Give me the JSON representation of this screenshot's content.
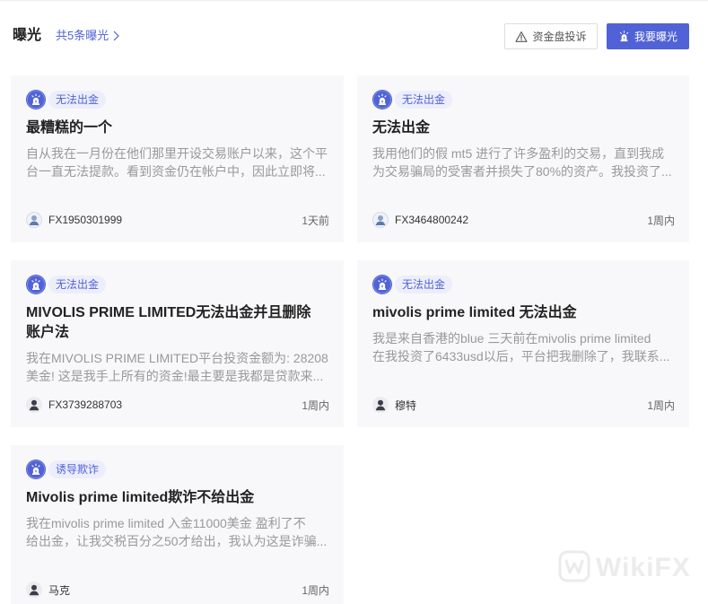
{
  "header": {
    "title": "曝光",
    "count_link": "共5条曝光",
    "count_link_icon": "chevron-right-icon",
    "complaint_button": "资金盘投诉",
    "complaint_icon": "warning-triangle-icon",
    "expose_button": "我要曝光",
    "expose_icon": "siren-icon"
  },
  "colors": {
    "accent": "#5062d6",
    "tag_background": "#eceefb",
    "card_background": "#f8f8fa",
    "title_text": "#222222",
    "muted_text": "#999999"
  },
  "cards": [
    {
      "icon": "siren-icon",
      "tag": "无法出金",
      "title_lines": [
        "最糟糕的一个"
      ],
      "description_lines": [
        "自从我在一月份在他们那里开设交易账户以来，这个平",
        "台一直无法提款。看到资金仍在帐户中，因此立即将..."
      ],
      "avatar": "user-avatar-icon",
      "author": "FX1950301999",
      "time": "1天前"
    },
    {
      "icon": "siren-icon",
      "tag": "无法出金",
      "title_lines": [
        "无法出金"
      ],
      "description_lines": [
        "我用他们的假 mt5 进行了许多盈利的交易，直到我成",
        "为交易骗局的受害者并损失了80%的资产。我投资了..."
      ],
      "avatar": "user-avatar-icon",
      "author": "FX3464800242",
      "time": "1周内"
    },
    {
      "icon": "siren-icon",
      "tag": "无法出金",
      "title_lines": [
        "MIVOLIS PRIME LIMITED无法出金并且删除",
        "账户法"
      ],
      "description_lines": [
        "我在MIVOLIS PRIME LIMITED平台投资金额为: 28208",
        "美金! 这是我手上所有的资金!最主要是我都是贷款来..."
      ],
      "avatar": "user-avatar-icon",
      "author": "FX3739288703",
      "time": "1周内"
    },
    {
      "icon": "siren-icon",
      "tag": "无法出金",
      "title_lines": [
        "mivolis prime limited 无法出金"
      ],
      "description_lines": [
        "我是来自香港的blue 三天前在mivolis prime limited",
        "在我投资了6433usd以后，平台把我删除了，我联系..."
      ],
      "avatar": "user-avatar-icon",
      "author": "穆特",
      "time": "1周内"
    },
    {
      "icon": "siren-icon",
      "tag": "诱导欺诈",
      "title_lines": [
        "Mivolis prime limited欺诈不给出金"
      ],
      "description_lines": [
        "我在mivolis prime limited 入金11000美金 盈利了不",
        "给出金，让我交税百分之50才给出，我认为这是诈骗..."
      ],
      "avatar": "user-avatar-icon",
      "author": "马克",
      "time": "1周内"
    }
  ],
  "watermark": "WikiFX",
  "watermark_icon": "wikifx-logo-icon"
}
